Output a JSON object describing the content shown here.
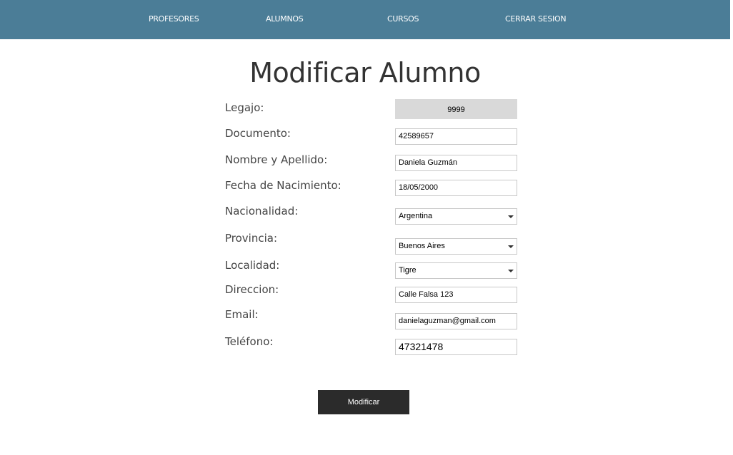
{
  "nav": {
    "items": [
      "PROFESORES",
      "ALUMNOS",
      "CURSOS",
      "CERRAR SESION"
    ],
    "color": "#4b7d97"
  },
  "title": "Modificar Alumno",
  "form": {
    "legajo": {
      "label": "Legajo:",
      "value": "9999"
    },
    "documento": {
      "label": "Documento:",
      "value": "42589657"
    },
    "nombre": {
      "label": "Nombre y Apellido:",
      "value": "Daniela Guzmán"
    },
    "fecha": {
      "label": "Fecha de Nacimiento:",
      "value": "18/05/2000"
    },
    "nacionalidad": {
      "label": "Nacionalidad:",
      "value": "Argentina"
    },
    "provincia": {
      "label": "Provincia:",
      "value": "Buenos Aires"
    },
    "localidad": {
      "label": "Localidad:",
      "value": "Tigre"
    },
    "direccion": {
      "label": "Direccion:",
      "value": "Calle Falsa 123"
    },
    "email": {
      "label": "Email:",
      "value": "danielaguzman@gmail.com"
    },
    "telefono": {
      "label": "Teléfono:",
      "value": "47321478"
    }
  },
  "submit_label": "Modificar"
}
